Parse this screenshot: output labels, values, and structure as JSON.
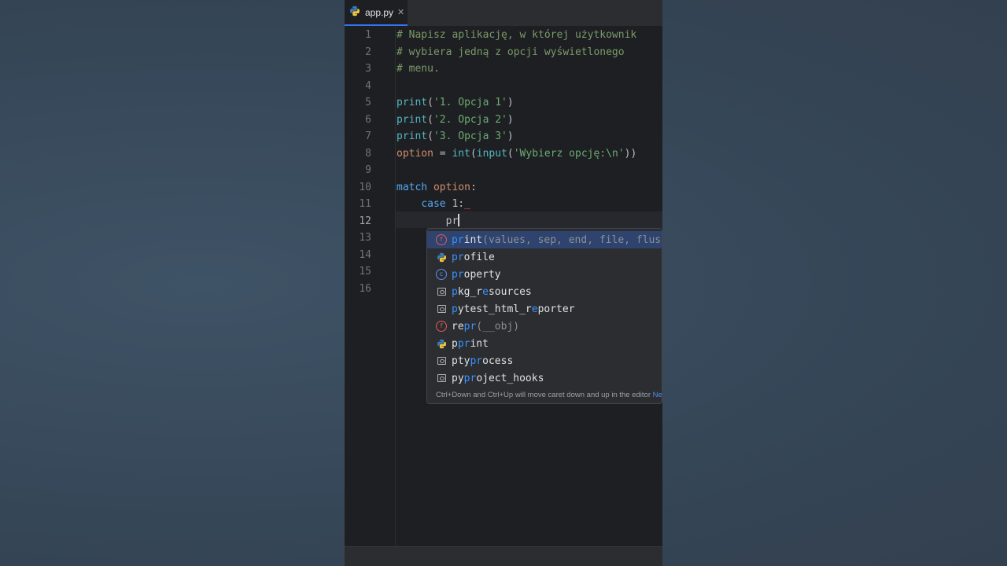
{
  "tab": {
    "file_name": "app.py",
    "close_glyph": "✕"
  },
  "editor": {
    "line_numbers": [
      "1",
      "2",
      "3",
      "4",
      "5",
      "6",
      "7",
      "8",
      "9",
      "10",
      "11",
      "12",
      "13",
      "14",
      "15",
      "16"
    ],
    "current_line": "12",
    "lines": [
      {
        "n": 1,
        "text": "# Napisz aplikację, w której użytkownik"
      },
      {
        "n": 2,
        "text": "# wybiera jedną z opcji wyświetlonego"
      },
      {
        "n": 3,
        "text": "# menu."
      },
      {
        "n": 4,
        "text": ""
      },
      {
        "n": 5,
        "text": "print('1. Opcja 1')"
      },
      {
        "n": 6,
        "text": "print('2. Opcja 2')"
      },
      {
        "n": 7,
        "text": "print('3. Opcja 3')"
      },
      {
        "n": 8,
        "text": "option = int(input('Wybierz opcję:\\n'))"
      },
      {
        "n": 9,
        "text": ""
      },
      {
        "n": 10,
        "text": "match option:"
      },
      {
        "n": 11,
        "text": "    case 1:"
      },
      {
        "n": 12,
        "text": "        pr"
      }
    ],
    "tokens": {
      "comment1": "# Napisz aplikację, w której użytkownik",
      "comment2": "# wybiera jedną z opcji wyświetlonego",
      "comment3": "# menu.",
      "print": "print",
      "str1": "'1. Opcja 1'",
      "str2": "'2. Opcja 2'",
      "str3": "'3. Opcja 3'",
      "option": "option",
      "eq": " = ",
      "int": "int",
      "input": "input",
      "str4": "'Wybierz opcję:\\n'",
      "match": "match",
      "colon": ":",
      "case": "case",
      "one": "1",
      "typed": "pr",
      "lparen": "(",
      "rparen": ")",
      "rparen2": "))",
      "squiggle": "_"
    }
  },
  "completion": {
    "items": [
      {
        "icon": "function-icon",
        "match": "pr",
        "rest": "int",
        "tail": "(values, sep, end, file, flus",
        "selected": true
      },
      {
        "icon": "python-module-icon",
        "match": "pr",
        "rest": "ofile",
        "tail": ""
      },
      {
        "icon": "class-icon",
        "match": "pr",
        "rest": "operty",
        "tail": ""
      },
      {
        "icon": "package-icon",
        "pre": "",
        "label": "pkg_resources",
        "tail": ""
      },
      {
        "icon": "package-icon",
        "label": "pytest_html_reporter",
        "tail": ""
      },
      {
        "icon": "function-icon",
        "label": "repr",
        "tail": "(__obj)"
      },
      {
        "icon": "python-module-icon",
        "label": "pprint",
        "tail": ""
      },
      {
        "icon": "package-icon",
        "label": "ptyprocess",
        "tail": ""
      },
      {
        "icon": "package-icon",
        "label": "pyproject_hooks",
        "tail": ""
      }
    ],
    "hint_text": "Ctrl+Down and Ctrl+Up will move caret down and up in the editor",
    "hint_link": "Ne"
  },
  "colors": {
    "accent": "#3574f0",
    "match_highlight": "#3b91ff",
    "selected_row": "#2e436e",
    "editor_bg": "#1e1f22"
  }
}
